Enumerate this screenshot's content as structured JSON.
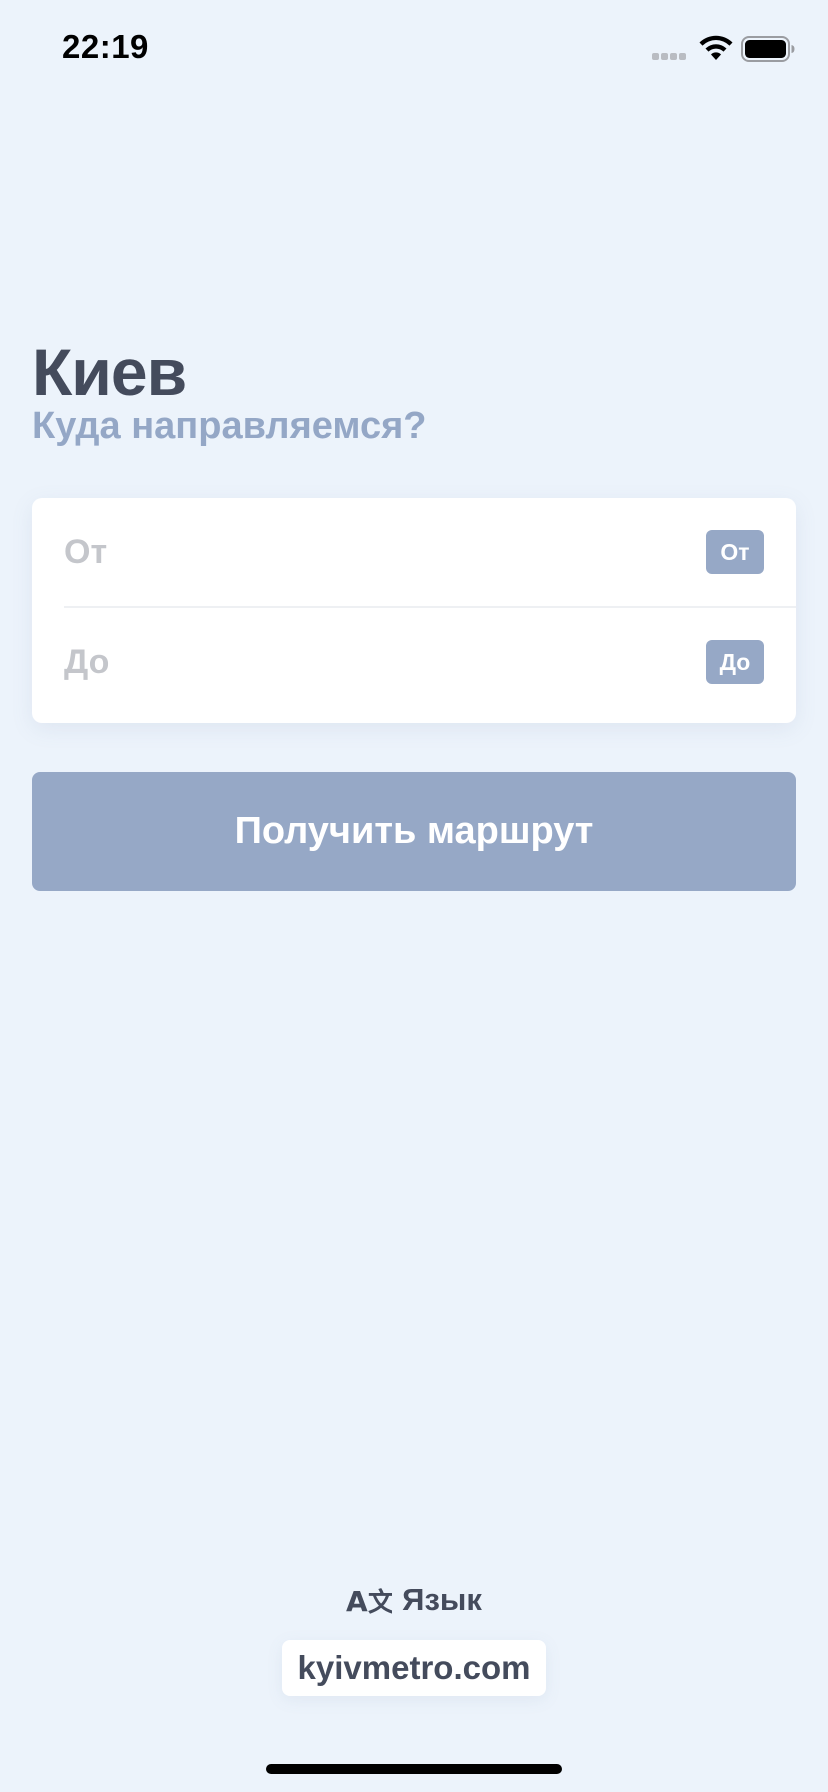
{
  "status_bar": {
    "time": "22:19",
    "icons": [
      "cellular-signal-icon",
      "wifi-icon",
      "battery-icon"
    ]
  },
  "header": {
    "city": "Киев",
    "subtitle": "Куда направляемся?"
  },
  "route_form": {
    "from": {
      "placeholder": "От",
      "badge": "От"
    },
    "to": {
      "placeholder": "До",
      "badge": "До"
    }
  },
  "actions": {
    "get_route": "Получить маршрут"
  },
  "footer": {
    "language_icon": "translate-icon",
    "language_label": "Язык",
    "site_link": "kyivmetro.com"
  },
  "colors": {
    "background": "#ecf3fb",
    "title": "#444b5c",
    "accent": "#96a8c6",
    "placeholder": "#c4c6cb"
  }
}
